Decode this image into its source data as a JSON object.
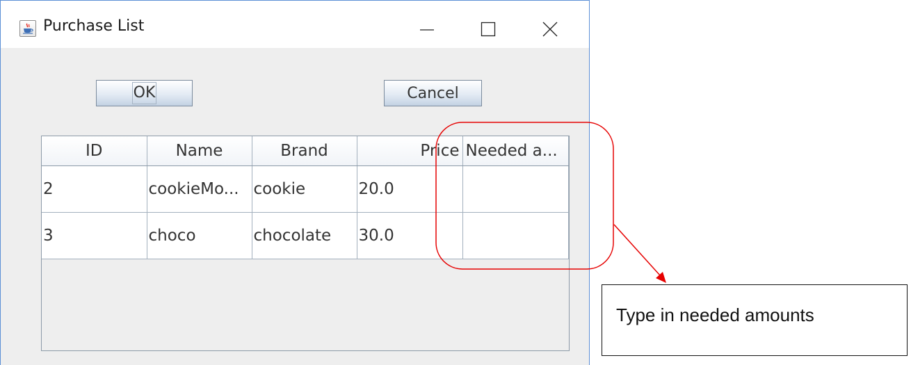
{
  "window": {
    "title": "Purchase List",
    "icon": "java-cup-icon"
  },
  "buttons": {
    "ok_label": "OK",
    "cancel_label": "Cancel"
  },
  "table": {
    "columns": [
      "ID",
      "Name",
      "Brand",
      "Price",
      "Needed a..."
    ],
    "rows": [
      [
        "2",
        "cookieMo...",
        "cookie",
        "20.0",
        ""
      ],
      [
        "3",
        "choco",
        "chocolate",
        "30.0",
        ""
      ]
    ]
  },
  "annotation": {
    "text": "Type in needed amounts",
    "highlight_color": "#e60000"
  },
  "colors": {
    "window_border": "#5b8fd6",
    "window_background": "#eeeeee",
    "button_gradient_bottom": "#c3d2e3"
  }
}
